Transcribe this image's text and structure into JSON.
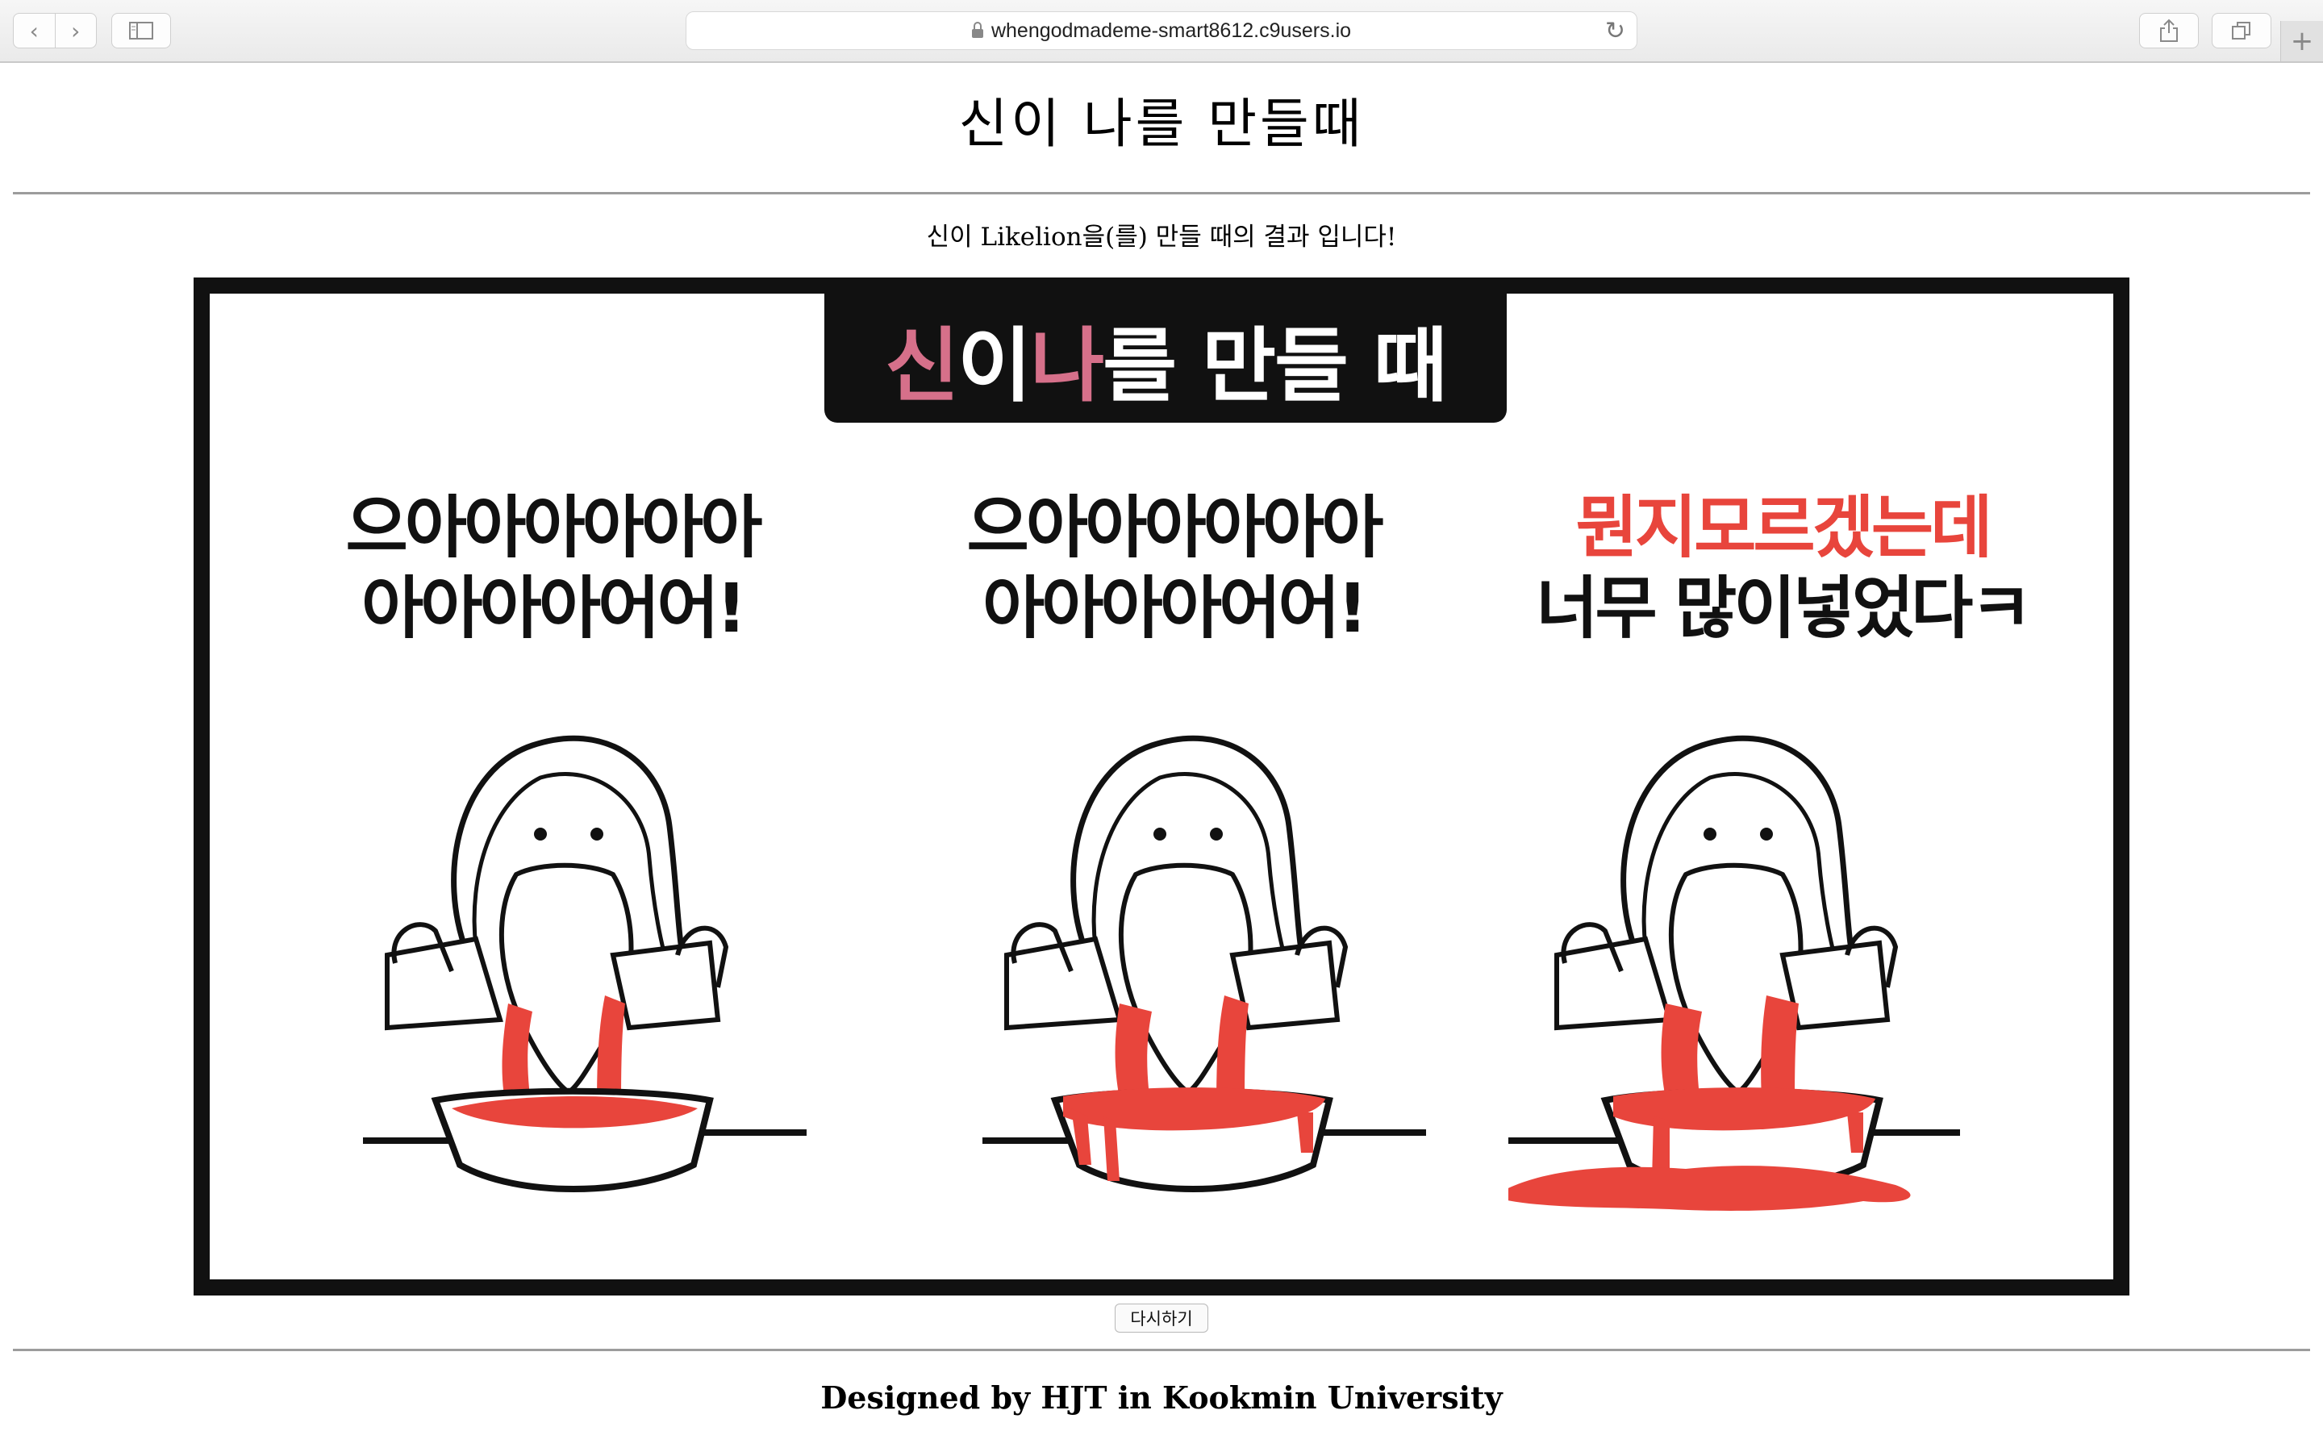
{
  "browser": {
    "url": "whengodmademe-smart8612.c9users.io",
    "back_icon": "‹",
    "forward_icon": "›",
    "reload_icon": "↻",
    "new_tab_icon": "+"
  },
  "page": {
    "title": "신이 나를 만들때",
    "subtitle": "신이 Likelion을(를) 만들 때의 결과 입니다!",
    "retry_label": "다시하기",
    "footer": "Designed by HJT in Kookmin University"
  },
  "comic": {
    "banner_1": "신",
    "banner_2": "이 ",
    "banner_3": "나",
    "banner_4": "를 만들 때",
    "panel1_line1": "으아아아아아아",
    "panel1_line2": "아아아아어어!",
    "panel2_line1": "으아아아아아아",
    "panel2_line2": "아아아아어어!",
    "panel3_line1": "뭔지모르겠는데",
    "panel3_line2": "너무  많이넣었다ㅋ",
    "accent_color": "#e8453c",
    "banner_pink": "#d6708a"
  }
}
